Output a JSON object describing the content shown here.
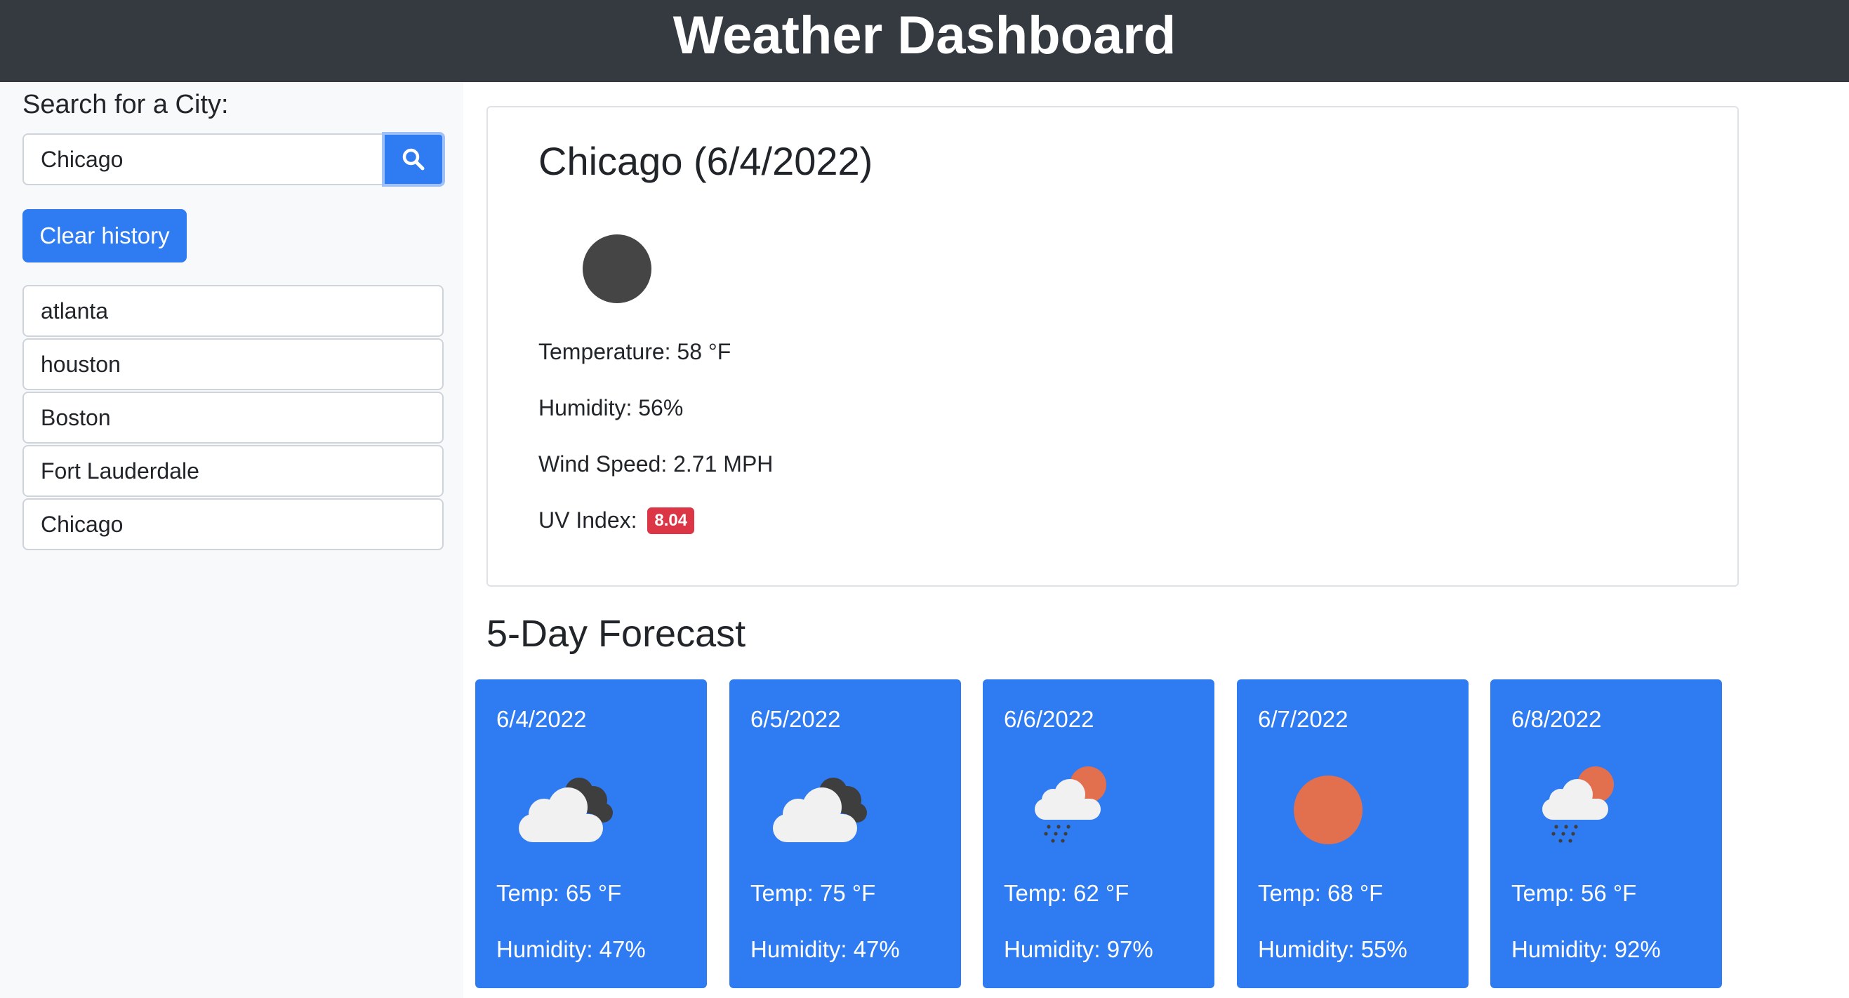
{
  "header": {
    "title": "Weather Dashboard"
  },
  "sidebar": {
    "search_label": "Search for a City:",
    "search_value": "Chicago",
    "search_icon": "search-icon",
    "clear_label": "Clear history",
    "history": [
      "atlanta",
      "houston",
      "Boston",
      "Fort Lauderdale",
      "Chicago"
    ]
  },
  "current": {
    "title": "Chicago (6/4/2022)",
    "icon": "dark-circle-icon",
    "temperature": "Temperature: 58 °F",
    "humidity": "Humidity: 56%",
    "wind": "Wind Speed: 2.71 MPH",
    "uv_label": "UV Index:",
    "uv_value": "8.04"
  },
  "forecast": {
    "title": "5-Day Forecast",
    "days": [
      {
        "date": "6/4/2022",
        "icon": "broken-clouds-icon",
        "temp": "Temp: 65 °F",
        "humidity": "Humidity: 47%"
      },
      {
        "date": "6/5/2022",
        "icon": "broken-clouds-icon",
        "temp": "Temp: 75 °F",
        "humidity": "Humidity: 47%"
      },
      {
        "date": "6/6/2022",
        "icon": "rain-sun-icon",
        "temp": "Temp: 62 °F",
        "humidity": "Humidity: 97%"
      },
      {
        "date": "6/7/2022",
        "icon": "sun-icon",
        "temp": "Temp: 68 °F",
        "humidity": "Humidity: 55%"
      },
      {
        "date": "6/8/2022",
        "icon": "rain-sun-icon",
        "temp": "Temp: 56 °F",
        "humidity": "Humidity: 92%"
      }
    ]
  },
  "colors": {
    "header_bg": "#343a40",
    "primary": "#2f7bf1",
    "uv_badge": "#dc3545",
    "sidebar_bg": "#f8f9fa"
  }
}
